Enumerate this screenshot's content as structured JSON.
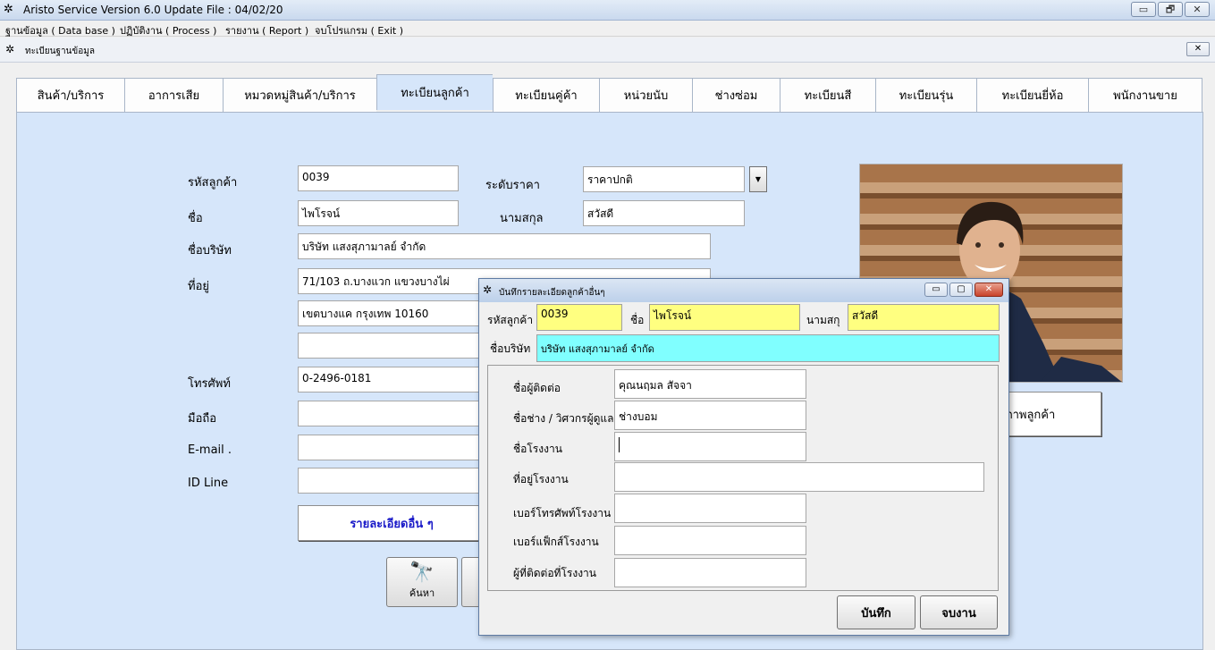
{
  "window": {
    "title": "Aristo Service Version 6.0 Update File : 04/02/20",
    "min": "▭",
    "max": "🗗",
    "close": "✕"
  },
  "menu": [
    "ฐานข้อมูล ( Data base )",
    "ปฏิบัติงาน ( Process )",
    "รายงาน ( Report )",
    "จบโปรแกรม ( Exit )"
  ],
  "subwindow": {
    "title": "ทะเบียนฐานข้อมูล",
    "close": "✕"
  },
  "tabs": [
    "สินค้า/บริการ",
    "อาการเสีย",
    "หมวดหมู่สินค้า/บริการ",
    "ทะเบียนลูกค้า",
    "ทะเบียนคู่ค้า",
    "หน่วยนับ",
    "ช่างซ่อม",
    "ทะเบียนสี",
    "ทะเบียนรุ่น",
    "ทะเบียนยี่ห้อ",
    "พนักงานขาย"
  ],
  "form": {
    "customer_code_label": "รหัสลูกค้า",
    "customer_code": "0039",
    "price_level_label": "ระดับราคา",
    "price_level": "ราคาปกติ",
    "name_label": "ชื่อ",
    "name": "ไพโรจน์",
    "surname_label": "นามสกุล",
    "surname": "สวัสดี",
    "company_label": "ชื่อบริษัท",
    "company": "บริษัท แสงสุภามาลย์ จำกัด",
    "address_label": "ที่อยู่",
    "address1": "71/103 ถ.บางแวก แขวงบางไผ่",
    "address2": "เขตบางแค กรุงเทพ 10160",
    "address3": "",
    "phone_label": "โทรศัพท์",
    "phone": "0-2496-0181",
    "mobile_label": "มือถือ",
    "mobile": "",
    "email_label": "E-mail .",
    "email": "",
    "line_label": "ID Line",
    "line": "",
    "more_details": "รายละเอียดอื่น ๆ",
    "search_button": "ค้นหา",
    "photo_button": "ภาพลูกค้า"
  },
  "dialog": {
    "title": "บันทึกรายละเอียดลูกค้าอื่นๆ",
    "code_label": "รหัสลูกค้า",
    "code": "0039",
    "name_label": "ชื่อ",
    "name": "ไพโรจน์",
    "surname_label": "นามสกุ",
    "surname": "สวัสดี",
    "company_label": "ชื่อบริษัท",
    "company": "บริษัท แสงสุภามาลย์ จำกัด",
    "contact_label": "ชื่อผู้ติดต่อ",
    "contact": "คุณนฤมล สัจจา",
    "technician_label": "ชื่อช่าง / วิศวกรผู้ดูแล",
    "technician": "ช่างบอม",
    "factory_label": "ชื่อโรงงาน",
    "factory": "",
    "factory_addr_label": "ที่อยู่โรงงาน",
    "factory_addr": "",
    "factory_phone_label": "เบอร์โทรศัพท์โรงงาน",
    "factory_phone": "",
    "factory_fax_label": "เบอร์แฟ็กส์โรงงาน",
    "factory_fax": "",
    "factory_contact_label": "ผู้ที่ติดต่อที่โรงงาน",
    "factory_contact": "",
    "save": "บันทึก",
    "close": "จบงาน"
  }
}
